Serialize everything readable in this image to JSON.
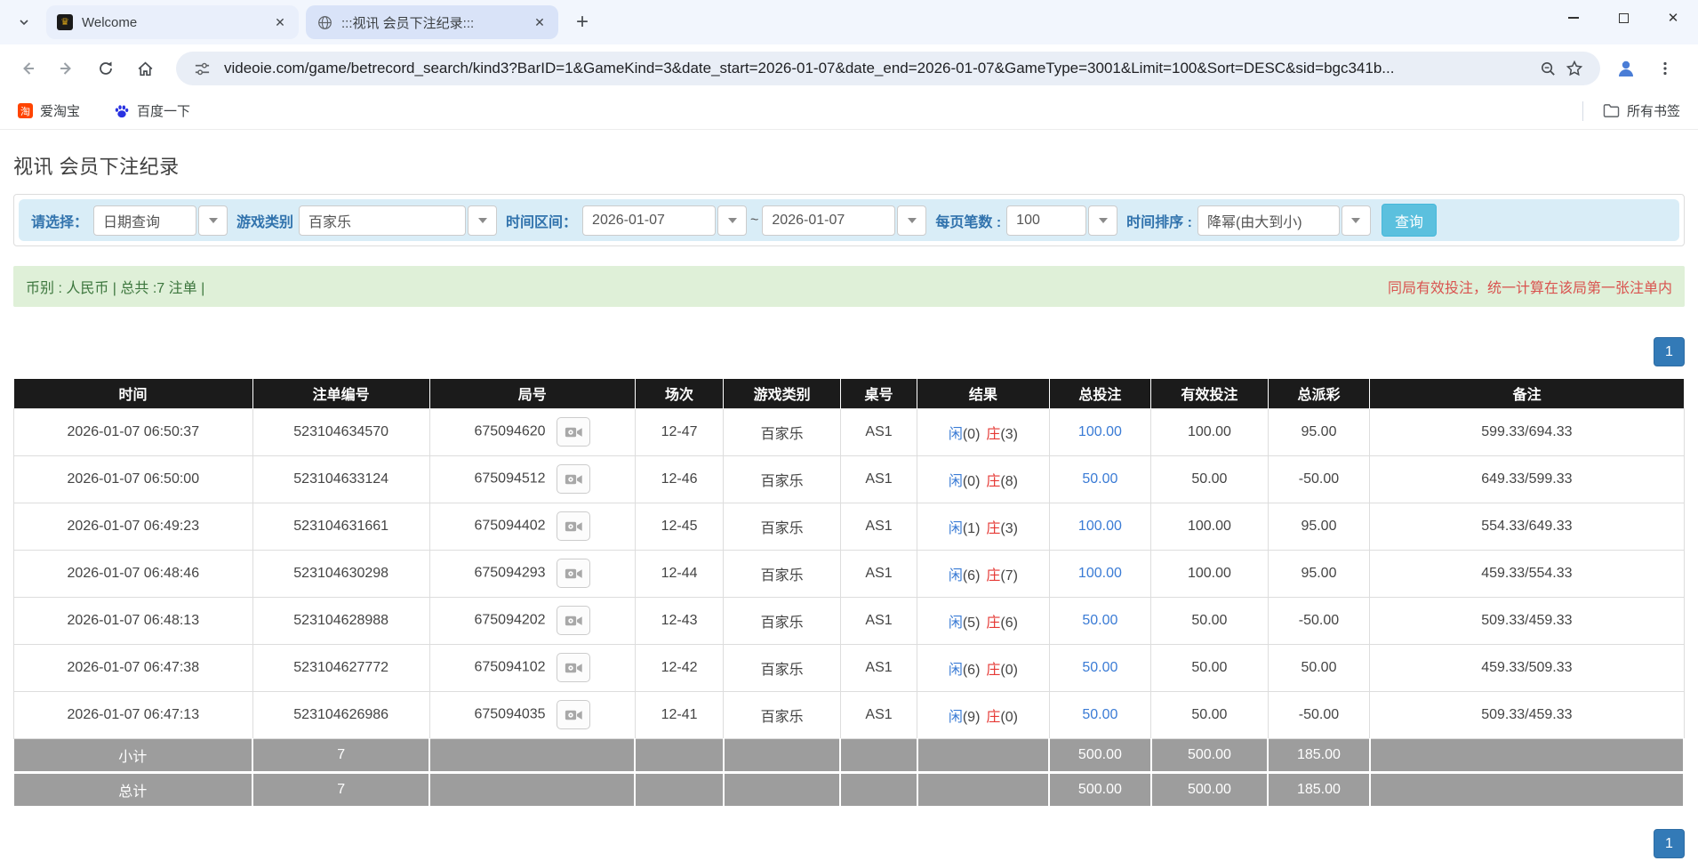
{
  "browser": {
    "tabs": [
      {
        "title": "Welcome"
      },
      {
        "title": ":::视讯 会员下注纪录:::"
      }
    ],
    "url": "videoie.com/game/betrecord_search/kind3?BarID=1&GameKind=3&date_start=2026-01-07&date_end=2026-01-07&GameType=3001&Limit=100&Sort=DESC&sid=bgc341b...",
    "bookmarks": [
      {
        "label": "爱淘宝",
        "icon": "taobao-icon"
      },
      {
        "label": "百度一下",
        "icon": "baidu-paw-icon"
      }
    ],
    "all_bookmarks_label": "所有书签"
  },
  "page": {
    "title": "视讯 会员下注纪录",
    "filters": {
      "select_label": "请选择：",
      "select_value": "日期查询",
      "game_kind_label": "游戏类别",
      "game_kind_value": "百家乐",
      "date_range_label": "时间区间：",
      "date_start": "2026-01-07",
      "tilde": "~",
      "date_end": "2026-01-07",
      "per_page_label": "每页笔数 :",
      "per_page_value": "100",
      "sort_label": "时间排序 :",
      "sort_value": "降幂(由大到小)",
      "search_button": "查询"
    },
    "summary": {
      "left": "币别 : 人民币 | 总共 :7 注单 |",
      "right": "同局有效投注，统一计算在该局第一张注单内"
    },
    "pagination": {
      "page": "1"
    },
    "table": {
      "headers": [
        "时间",
        "注单编号",
        "局号",
        "场次",
        "游戏类别",
        "桌号",
        "结果",
        "总投注",
        "有效投注",
        "总派彩",
        "备注"
      ],
      "rows": [
        {
          "time": "2026-01-07 06:50:37",
          "bet_id": "523104634570",
          "round_id": "675094620",
          "session": "12-47",
          "game": "百家乐",
          "table_no": "AS1",
          "result_player": "闲",
          "result_player_score": "(0)",
          "result_banker": "庄",
          "result_banker_score": "(3)",
          "total_bet": "100.00",
          "valid_bet": "100.00",
          "payout": "95.00",
          "remark": "599.33/694.33"
        },
        {
          "time": "2026-01-07 06:50:00",
          "bet_id": "523104633124",
          "round_id": "675094512",
          "session": "12-46",
          "game": "百家乐",
          "table_no": "AS1",
          "result_player": "闲",
          "result_player_score": "(0)",
          "result_banker": "庄",
          "result_banker_score": "(8)",
          "total_bet": "50.00",
          "valid_bet": "50.00",
          "payout": "-50.00",
          "remark": "649.33/599.33"
        },
        {
          "time": "2026-01-07 06:49:23",
          "bet_id": "523104631661",
          "round_id": "675094402",
          "session": "12-45",
          "game": "百家乐",
          "table_no": "AS1",
          "result_player": "闲",
          "result_player_score": "(1)",
          "result_banker": "庄",
          "result_banker_score": "(3)",
          "total_bet": "100.00",
          "valid_bet": "100.00",
          "payout": "95.00",
          "remark": "554.33/649.33"
        },
        {
          "time": "2026-01-07 06:48:46",
          "bet_id": "523104630298",
          "round_id": "675094293",
          "session": "12-44",
          "game": "百家乐",
          "table_no": "AS1",
          "result_player": "闲",
          "result_player_score": "(6)",
          "result_banker": "庄",
          "result_banker_score": "(7)",
          "total_bet": "100.00",
          "valid_bet": "100.00",
          "payout": "95.00",
          "remark": "459.33/554.33"
        },
        {
          "time": "2026-01-07 06:48:13",
          "bet_id": "523104628988",
          "round_id": "675094202",
          "session": "12-43",
          "game": "百家乐",
          "table_no": "AS1",
          "result_player": "闲",
          "result_player_score": "(5)",
          "result_banker": "庄",
          "result_banker_score": "(6)",
          "total_bet": "50.00",
          "valid_bet": "50.00",
          "payout": "-50.00",
          "remark": "509.33/459.33"
        },
        {
          "time": "2026-01-07 06:47:38",
          "bet_id": "523104627772",
          "round_id": "675094102",
          "session": "12-42",
          "game": "百家乐",
          "table_no": "AS1",
          "result_player": "闲",
          "result_player_score": "(6)",
          "result_banker": "庄",
          "result_banker_score": "(0)",
          "total_bet": "50.00",
          "valid_bet": "50.00",
          "payout": "50.00",
          "remark": "459.33/509.33"
        },
        {
          "time": "2026-01-07 06:47:13",
          "bet_id": "523104626986",
          "round_id": "675094035",
          "session": "12-41",
          "game": "百家乐",
          "table_no": "AS1",
          "result_player": "闲",
          "result_player_score": "(9)",
          "result_banker": "庄",
          "result_banker_score": "(0)",
          "total_bet": "50.00",
          "valid_bet": "50.00",
          "payout": "-50.00",
          "remark": "509.33/459.33"
        }
      ],
      "footer": [
        {
          "label": "小计",
          "count": "7",
          "total_bet": "500.00",
          "valid_bet": "500.00",
          "payout": "185.00"
        },
        {
          "label": "总计",
          "count": "7",
          "total_bet": "500.00",
          "valid_bet": "500.00",
          "payout": "185.00"
        }
      ]
    },
    "colors": {
      "header_bg": "#1b1b1b",
      "footer_bg": "#9d9d9d",
      "link_blue": "#3a7bd5",
      "negative_red": "#e53935",
      "notice_red": "#d9534f",
      "summary_green_bg": "#dff0d8",
      "summary_green_text": "#3c763d",
      "filter_bar_bg": "#d9edf7",
      "filter_label_blue": "#3173ad",
      "search_button_bg": "#5bc0de",
      "pager_blue": "#337ab7"
    }
  }
}
